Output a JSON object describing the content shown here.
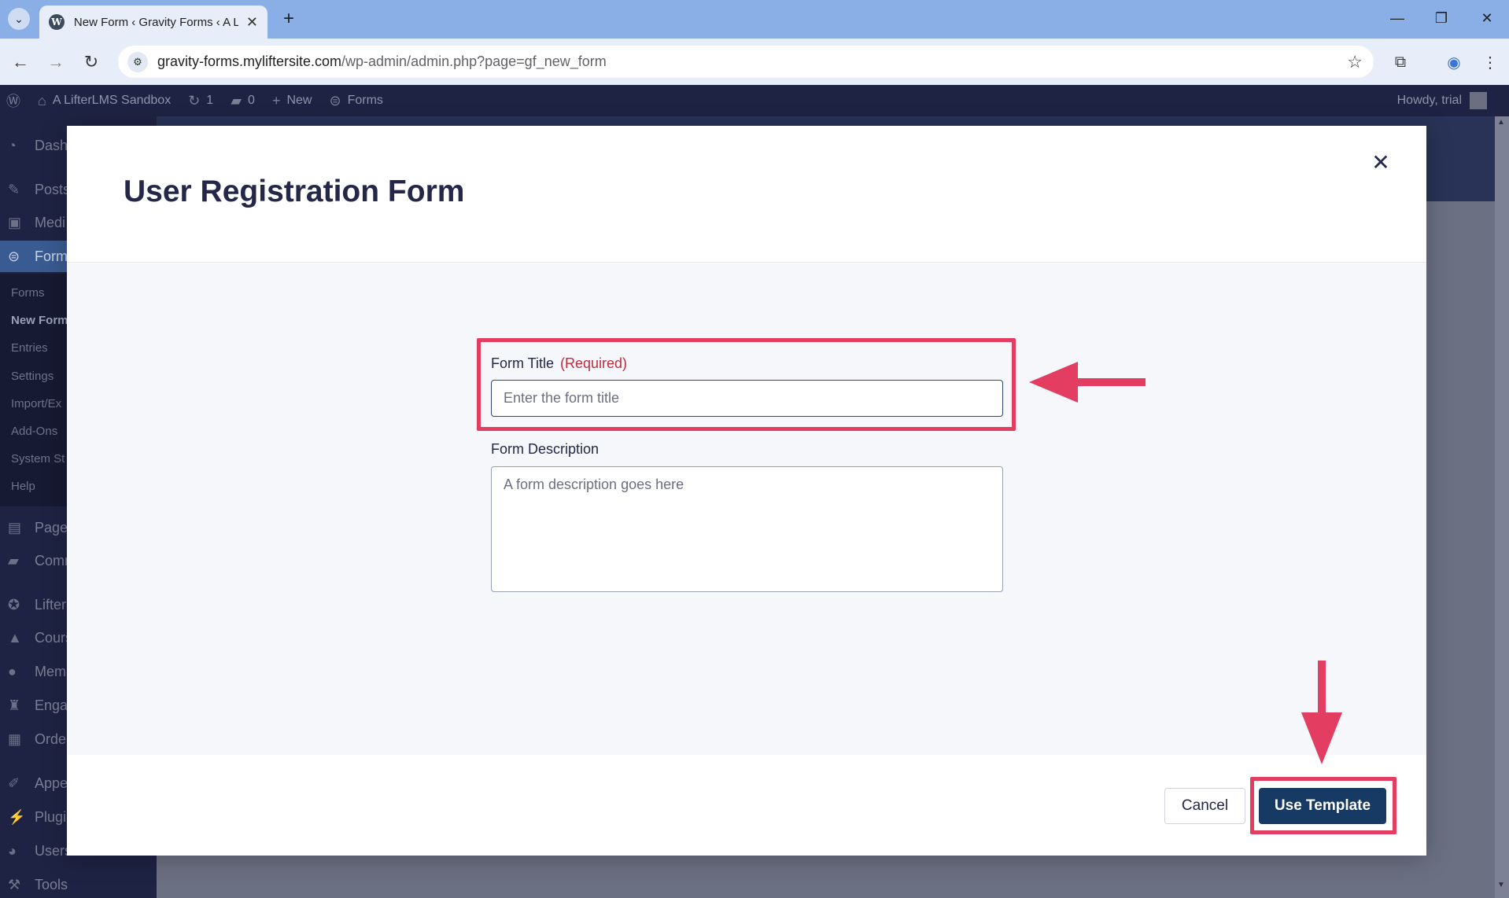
{
  "browser": {
    "tab_title": "New Form ‹ Gravity Forms ‹ A L",
    "favicon": "W",
    "url_host": "gravity-forms.myliftersite.com",
    "url_path": "/wp-admin/admin.php?page=gf_new_form"
  },
  "adminbar": {
    "site_name": "A LifterLMS Sandbox",
    "updates_count": "1",
    "comments_count": "0",
    "new_label": "New",
    "forms_label": "Forms",
    "howdy": "Howdy, trial"
  },
  "sidebar": {
    "items": [
      {
        "label": "Dash",
        "icon": "dashboard-icon"
      },
      {
        "label": "Posts",
        "icon": "pin-icon"
      },
      {
        "label": "Medi",
        "icon": "media-icon"
      },
      {
        "label": "Form",
        "icon": "forms-icon"
      },
      {
        "label": "Pages",
        "icon": "pages-icon"
      },
      {
        "label": "Comm",
        "icon": "comments-icon"
      },
      {
        "label": "Lifter",
        "icon": "lifter-icon"
      },
      {
        "label": "Cours",
        "icon": "courses-icon"
      },
      {
        "label": "Mem",
        "icon": "members-icon"
      },
      {
        "label": "Engag",
        "icon": "engagement-icon"
      },
      {
        "label": "Orde",
        "icon": "orders-icon"
      },
      {
        "label": "Appe",
        "icon": "appearance-icon"
      },
      {
        "label": "Plugi",
        "icon": "plugins-icon"
      },
      {
        "label": "Users",
        "icon": "users-icon"
      },
      {
        "label": "Tools",
        "icon": "tools-icon"
      }
    ],
    "submenu": [
      "Forms",
      "New Form",
      "Entries",
      "Settings",
      "Import/Ex",
      "Add-Ons",
      "System St",
      "Help"
    ]
  },
  "modal": {
    "title": "User Registration Form",
    "form_title_label": "Form Title",
    "required_label": "(Required)",
    "form_title_value": "",
    "form_title_placeholder": "Enter the form title",
    "form_description_label": "Form Description",
    "form_description_value": "",
    "form_description_placeholder": "A form description goes here",
    "cancel_label": "Cancel",
    "use_template_label": "Use Template"
  },
  "annotations": {
    "highlight_color": "#e33e62"
  },
  "colors": {
    "wp_admin_bg": "#1e2343",
    "primary_button": "#173a65",
    "required_text": "#c02b3c"
  }
}
